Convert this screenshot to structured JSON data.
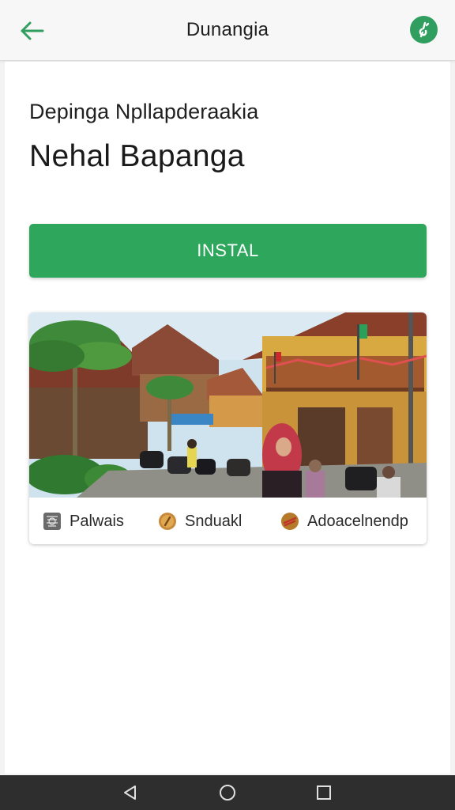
{
  "appbar": {
    "title": "Dunangia",
    "back_icon": "arrow-left-icon",
    "badge_icon": "app-badge-icon",
    "accent_color": "#2f9e5f"
  },
  "header": {
    "subtitle": "Depinga Npllapderaakia",
    "title": "Nehal Bapanga"
  },
  "install": {
    "label": "INSTAL",
    "color": "#2ea65c"
  },
  "preview": {
    "image_icon": "village-street-photo",
    "tags": [
      {
        "label": "Palwais",
        "icon": "pattern-icon"
      },
      {
        "label": "Snduakl",
        "icon": "bronze-coin-icon"
      },
      {
        "label": "Adoacelnendp",
        "icon": "striped-coin-icon"
      }
    ]
  },
  "navbar": {
    "back_icon": "triangle-back-icon",
    "home_icon": "circle-home-icon",
    "recent_icon": "square-recents-icon"
  }
}
